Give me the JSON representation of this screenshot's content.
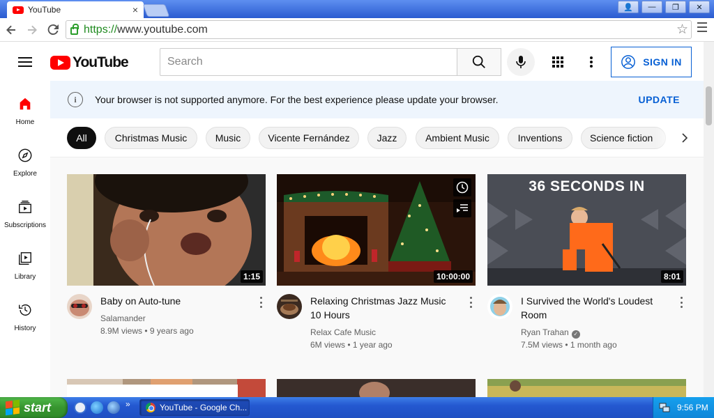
{
  "browser": {
    "tab_title": "YouTube",
    "tab_close": "×",
    "url_scheme": "https://",
    "url_host": "www.youtube.com",
    "window_buttons": [
      "👤",
      "—",
      "❐",
      "✕"
    ]
  },
  "header": {
    "logo_text": "YouTube",
    "search_placeholder": "Search",
    "signin_label": "SIGN IN"
  },
  "sidebar": {
    "items": [
      {
        "label": "Home",
        "icon": "home-icon"
      },
      {
        "label": "Explore",
        "icon": "compass-icon"
      },
      {
        "label": "Subscriptions",
        "icon": "subscriptions-icon"
      },
      {
        "label": "Library",
        "icon": "library-icon"
      },
      {
        "label": "History",
        "icon": "history-icon"
      }
    ]
  },
  "banner": {
    "message": "Your browser is not supported anymore. For the best experience please update your browser.",
    "action": "UPDATE"
  },
  "chips": [
    "All",
    "Christmas Music",
    "Music",
    "Vicente Fernández",
    "Jazz",
    "Ambient Music",
    "Inventions",
    "Science fiction"
  ],
  "videos": [
    {
      "title": "Baby on Auto-tune",
      "channel": "Salamander",
      "views": "8.9M views",
      "age": "9 years ago",
      "duration": "1:15",
      "verified": false
    },
    {
      "title": "Relaxing Christmas Jazz Music 10 Hours",
      "channel": "Relax Cafe Music",
      "views": "6M views",
      "age": "1 year ago",
      "duration": "10:00:00",
      "verified": false
    },
    {
      "title": "I Survived the World's Loudest Room",
      "channel": "Ryan Trahan",
      "views": "7.5M views",
      "age": "1 month ago",
      "duration": "8:01",
      "verified": true,
      "thumb_text": "36 SECONDS IN"
    }
  ],
  "taskbar": {
    "start_label": "start",
    "task_title": "YouTube - Google Ch...",
    "clock": "9:56 PM"
  },
  "colors": {
    "brand_red": "#ff0000",
    "link_blue": "#065fd4",
    "banner_bg": "#eef5fd"
  }
}
